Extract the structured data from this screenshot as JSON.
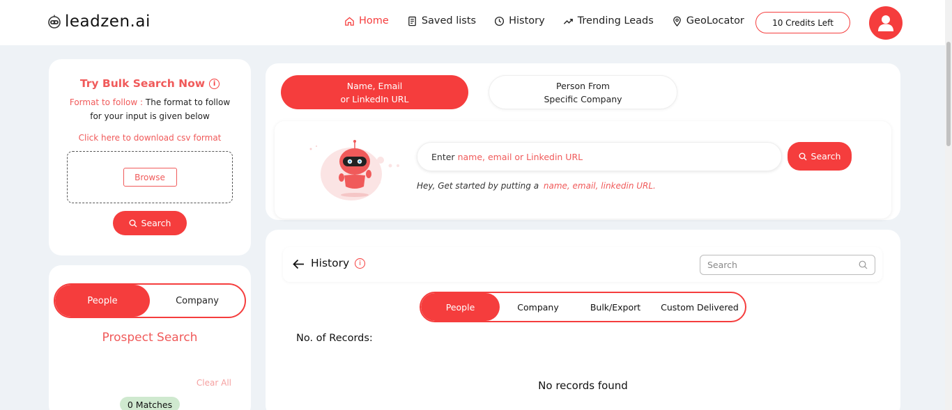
{
  "header": {
    "logo_text": "leadzen.ai",
    "nav": [
      {
        "label": "Home",
        "icon": "home-icon",
        "active": true
      },
      {
        "label": "Saved lists",
        "icon": "list-icon",
        "active": false
      },
      {
        "label": "History",
        "icon": "clock-icon",
        "active": false
      },
      {
        "label": "Trending Leads",
        "icon": "trend-icon",
        "active": false
      },
      {
        "label": "GeoLocator",
        "icon": "location-pin-icon",
        "active": false
      }
    ],
    "credits_label": "10 Credits Left",
    "avatar_icon": "user-avatar-icon"
  },
  "bulk": {
    "title": "Try Bulk Search Now",
    "format_prefix": "Format to follow :",
    "format_text": "The format to follow for your input is given below",
    "download_link": "Click here to download csv format",
    "browse_label": "Browse",
    "search_label": "Search"
  },
  "prospect": {
    "toggle": [
      "People",
      "Company"
    ],
    "title": "Prospect Search",
    "clear_all": "Clear All",
    "matches": "0 Matches"
  },
  "search": {
    "tabs": [
      {
        "line1": "Name, Email",
        "line2": "or LinkedIn URL"
      },
      {
        "line1": "Person From",
        "line2": "Specific Company"
      }
    ],
    "input_prefix": "Enter",
    "input_hint": "name, email or Linkedin URL",
    "search_label": "Search",
    "helper_prefix": "Hey, Get started by putting a",
    "helper_hint": "name, email, linkedin URL."
  },
  "history": {
    "title": "History",
    "search_placeholder": "Search",
    "tabs": [
      "People",
      "Company",
      "Bulk/Export",
      "Custom Delivered"
    ],
    "records_label": "No. of Records:",
    "empty_message": "No records found"
  },
  "colors": {
    "accent": "#f53d3d",
    "accent_text": "#f05a5a",
    "background": "#eef2f6",
    "match_badge": "#cfe9cf"
  }
}
